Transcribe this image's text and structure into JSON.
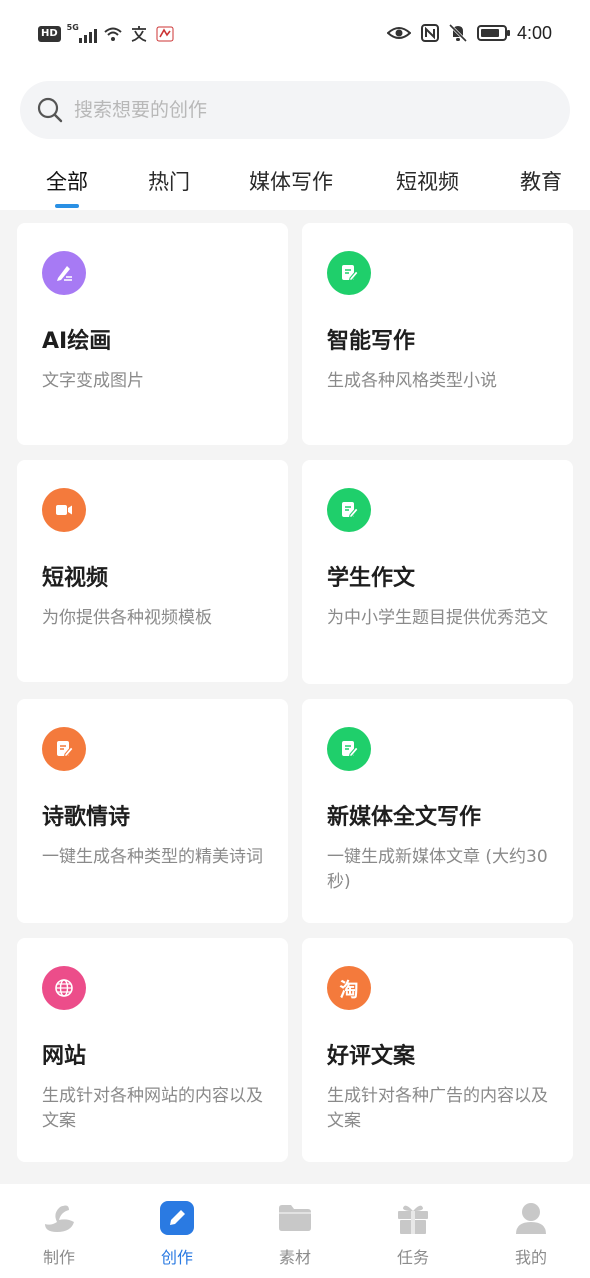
{
  "status_bar": {
    "left_icons": [
      "hd-icon",
      "5g-signal-icon",
      "wifi-icon",
      "translate-icon",
      "app-notification-icon"
    ],
    "hd_label": "HD",
    "network_label": "5G",
    "right_icons": [
      "eye-icon",
      "nfc-icon",
      "mute-bell-icon",
      "battery-icon"
    ],
    "time": "4:00"
  },
  "search": {
    "placeholder": "搜索想要的创作",
    "icon": "search-icon"
  },
  "tabs": [
    {
      "label": "全部",
      "active": true
    },
    {
      "label": "热门",
      "active": false
    },
    {
      "label": "媒体写作",
      "active": false
    },
    {
      "label": "短视频",
      "active": false
    },
    {
      "label": "教育",
      "active": false
    }
  ],
  "cards": [
    {
      "title": "AI绘画",
      "desc": "文字变成图片",
      "icon": "pen-drawing-icon",
      "icon_color": "#a77af4"
    },
    {
      "title": "智能写作",
      "desc": "生成各种风格类型小说",
      "icon": "write-note-icon",
      "icon_color": "#1fcf6b"
    },
    {
      "title": "短视频",
      "desc": "为你提供各种视频模板",
      "icon": "video-camera-icon",
      "icon_color": "#f47a3c"
    },
    {
      "title": "学生作文",
      "desc": "为中小学生题目提供优秀范文",
      "icon": "write-note-icon",
      "icon_color": "#1fcf6b"
    },
    {
      "title": "诗歌情诗",
      "desc": "一键生成各种类型的精美诗词",
      "icon": "edit-document-icon",
      "icon_color": "#f47a3c"
    },
    {
      "title": "新媒体全文写作",
      "desc": "一键生成新媒体文章 (大约30秒)",
      "icon": "write-note-icon",
      "icon_color": "#1fcf6b"
    },
    {
      "title": "网站",
      "desc": "生成针对各种网站的内容以及文案",
      "icon": "globe-icon",
      "icon_color": "#ec4d8a"
    },
    {
      "title": "好评文案",
      "desc": "生成针对各种广告的内容以及文案",
      "icon": "taobao-icon",
      "icon_color": "#f47a3c",
      "icon_text": "淘"
    }
  ],
  "bottom_nav": [
    {
      "label": "制作",
      "icon": "swan-icon",
      "active": false
    },
    {
      "label": "创作",
      "icon": "edit-pencil-icon",
      "active": true
    },
    {
      "label": "素材",
      "icon": "folder-icon",
      "active": false
    },
    {
      "label": "任务",
      "icon": "gift-icon",
      "active": false
    },
    {
      "label": "我的",
      "icon": "user-icon",
      "active": false
    }
  ],
  "colors": {
    "accent": "#2a7ae2",
    "tab_underline": "#2a90e4",
    "page_bg": "#f4f4f4",
    "inactive_nav": "#c8c8c8"
  }
}
